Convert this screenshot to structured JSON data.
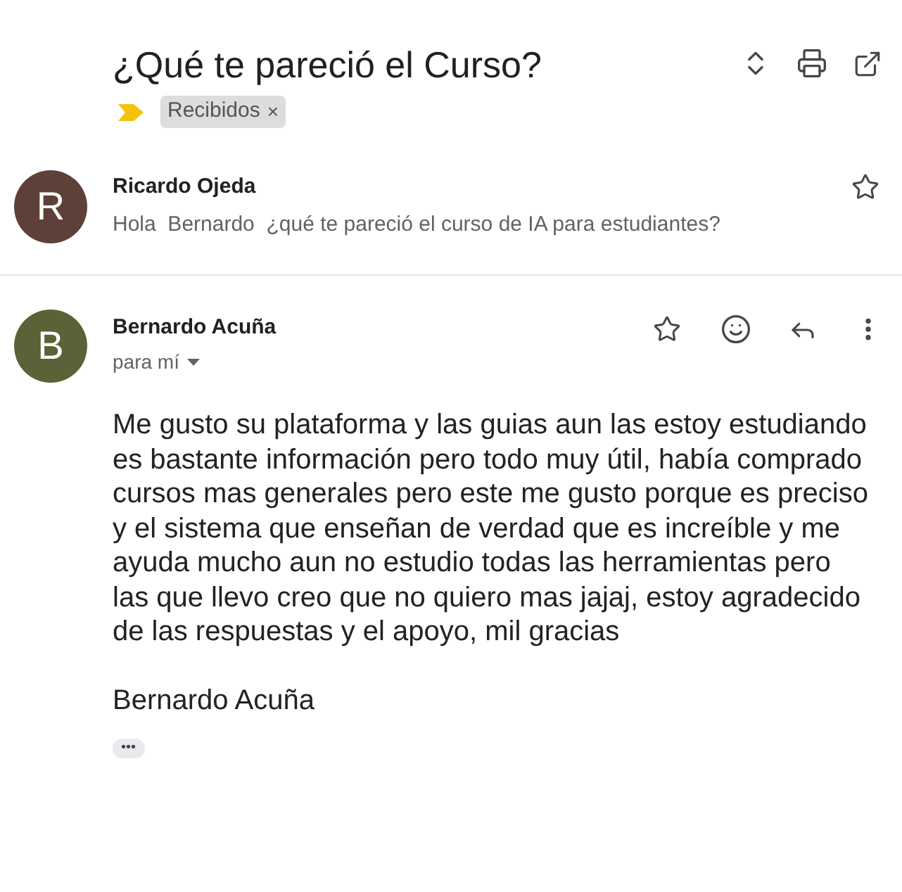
{
  "thread": {
    "subject": "¿Qué te pareció el Curso?",
    "important": true,
    "labels": [
      {
        "text": "Recibidos",
        "remove": "×"
      }
    ]
  },
  "messages": [
    {
      "kind": "collapsed",
      "avatar_letter": "R",
      "color": "#5d4037",
      "sender": "Ricardo Ojeda",
      "snippet": "Hola  Bernardo  ¿qué te pareció el curso de IA para estudiantes?",
      "starred": false
    },
    {
      "kind": "expanded",
      "avatar_letter": "B",
      "color": "#5a6237",
      "sender": "Bernardo Acuña",
      "recipient": "para mí",
      "starred": false,
      "body_lines": [
        "Me gusto su plataforma y las guias aun las estoy estudiando",
        "es bastante información pero todo muy útil, había comprado",
        "cursos mas generales pero este me gusto porque es preciso",
        "y el sistema que enseñan de verdad que es increíble y me",
        "ayuda mucho aun no estudio todas las herramientas pero",
        "las que llevo creo que no quiero mas jajaj, estoy agradecido",
        "de las respuestas y el apoyo, mil gracias"
      ],
      "signature": "Bernardo Acuña",
      "trimmed": "•••"
    }
  ]
}
